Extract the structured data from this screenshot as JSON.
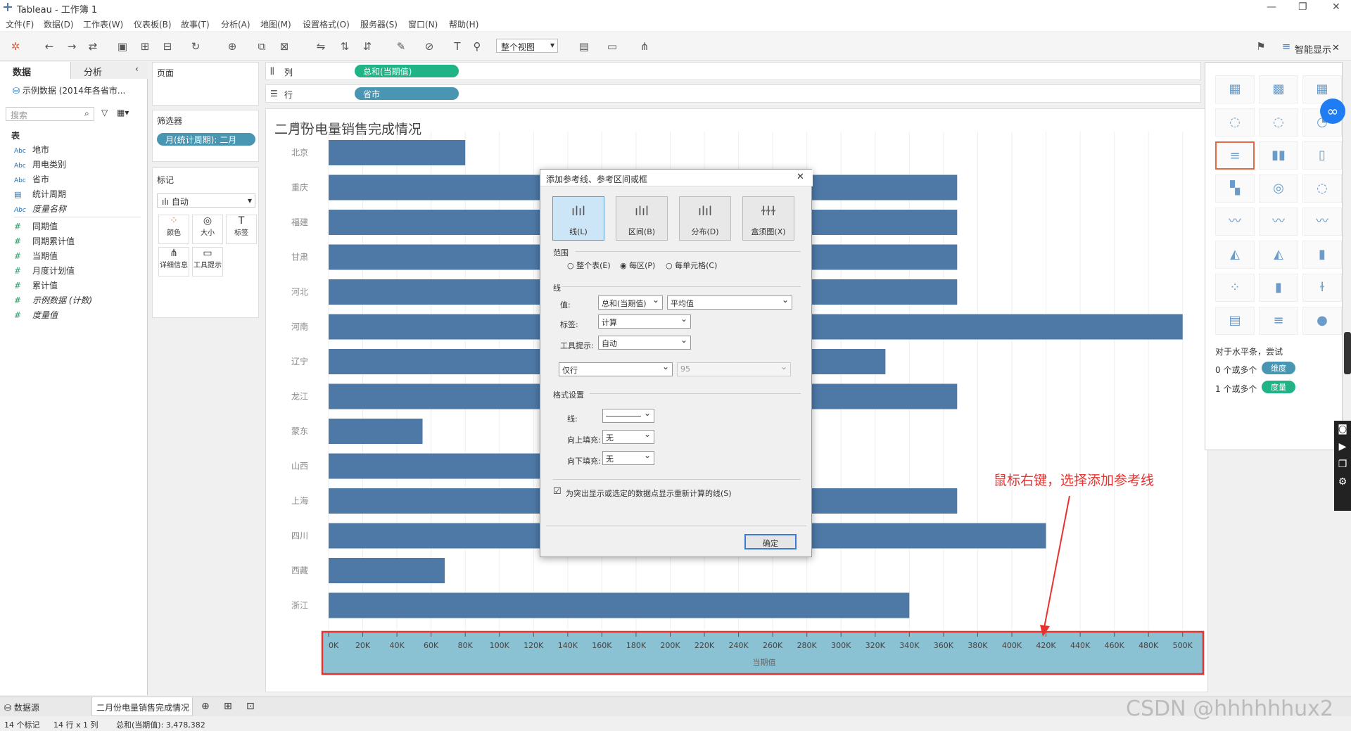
{
  "app": {
    "title": "Tableau - 工作簿 1"
  },
  "menu": [
    "文件(F)",
    "数据(D)",
    "工作表(W)",
    "仪表板(B)",
    "故事(T)",
    "分析(A)",
    "地图(M)",
    "设置格式(O)",
    "服务器(S)",
    "窗口(N)",
    "帮助(H)"
  ],
  "toolbar": {
    "view_select": "整个视图",
    "showme_label": "智能显示"
  },
  "left_panel": {
    "tabs": [
      "数据",
      "分析"
    ],
    "datasource": "示例数据 (2014年各省市...",
    "search_placeholder": "搜索",
    "section_table": "表",
    "dimensions": [
      "地市",
      "用电类别",
      "省市",
      "统计周期",
      "度量名称"
    ],
    "measures": [
      "同期值",
      "同期累计值",
      "当期值",
      "月度计划值",
      "累计值",
      "示例数据 (计数)",
      "度量值"
    ]
  },
  "pages": {
    "label": "页面"
  },
  "filters": {
    "label": "筛选器",
    "pill": "月(统计周期): 二月"
  },
  "marks": {
    "label": "标记",
    "type": "自动",
    "buttons": [
      "颜色",
      "大小",
      "标签",
      "详细信息",
      "工具提示"
    ]
  },
  "shelves": {
    "columns_label": "列",
    "columns_pill": "总和(当期值)",
    "rows_label": "行",
    "rows_pill": "省市"
  },
  "chart_data": {
    "type": "bar",
    "title": "二月份电量销售完成情况",
    "row_header": "省市",
    "xlabel": "当期值",
    "categories": [
      "北京",
      "重庆",
      "福建",
      "甘肃",
      "河北",
      "河南",
      "辽宁",
      "龙江",
      "蒙东",
      "山西",
      "上海",
      "四川",
      "西藏",
      "浙江"
    ],
    "values": [
      80000,
      368000,
      368000,
      368000,
      368000,
      500000,
      326000,
      368000,
      55000,
      273000,
      368000,
      420000,
      68000,
      340000
    ],
    "xlim": [
      0,
      510000
    ],
    "ticks": [
      "0K",
      "20K",
      "40K",
      "60K",
      "80K",
      "100K",
      "120K",
      "140K",
      "160K",
      "180K",
      "200K",
      "220K",
      "240K",
      "260K",
      "280K",
      "300K",
      "320K",
      "340K",
      "360K",
      "380K",
      "400K",
      "420K",
      "440K",
      "460K",
      "480K",
      "500K"
    ]
  },
  "dialog": {
    "title": "添加参考线、参考区间或框",
    "types": [
      "线(L)",
      "区间(B)",
      "分布(D)",
      "盒须图(X)"
    ],
    "scope_label": "范围",
    "scope_options": [
      "整个表(E)",
      "每区(P)",
      "每单元格(C)"
    ],
    "line_label": "线",
    "value_label": "值:",
    "value_field": "总和(当期值)",
    "value_agg": "平均值",
    "label_label": "标签:",
    "label_value": "计算",
    "tooltip_label": "工具提示:",
    "tooltip_value": "自动",
    "ci_select": "仅行",
    "ci_value": "95",
    "format_label": "格式设置",
    "line_fmt_label": "线:",
    "fill_above_label": "向上填充:",
    "fill_above": "无",
    "fill_below_label": "向下填充:",
    "fill_below": "无",
    "checkbox_label": "为突出显示或选定的数据点显示重新计算的线(S)",
    "ok": "确定"
  },
  "showme": {
    "hint": "对于水平条，尝试",
    "dim_text": "0 个或多个",
    "dim_pill": "维度",
    "mea_text": "1 个或多个",
    "mea_pill": "度量"
  },
  "annotation": "鼠标右键，选择添加参考线",
  "bottom_tabs": {
    "datasource": "数据源",
    "sheet": "二月份电量销售完成情况"
  },
  "status": {
    "marks": "14 个标记",
    "dims": "14 行 x 1 列",
    "sum": "总和(当期值): 3,478,382"
  },
  "watermark": "CSDN @hhhhhhux2",
  "colors": {
    "bar": "#4e79a7",
    "pill_green": "#1fb385",
    "pill_blue": "#4996b2",
    "axis_band": "#8ac1d3",
    "annotation": "#e8322f"
  }
}
